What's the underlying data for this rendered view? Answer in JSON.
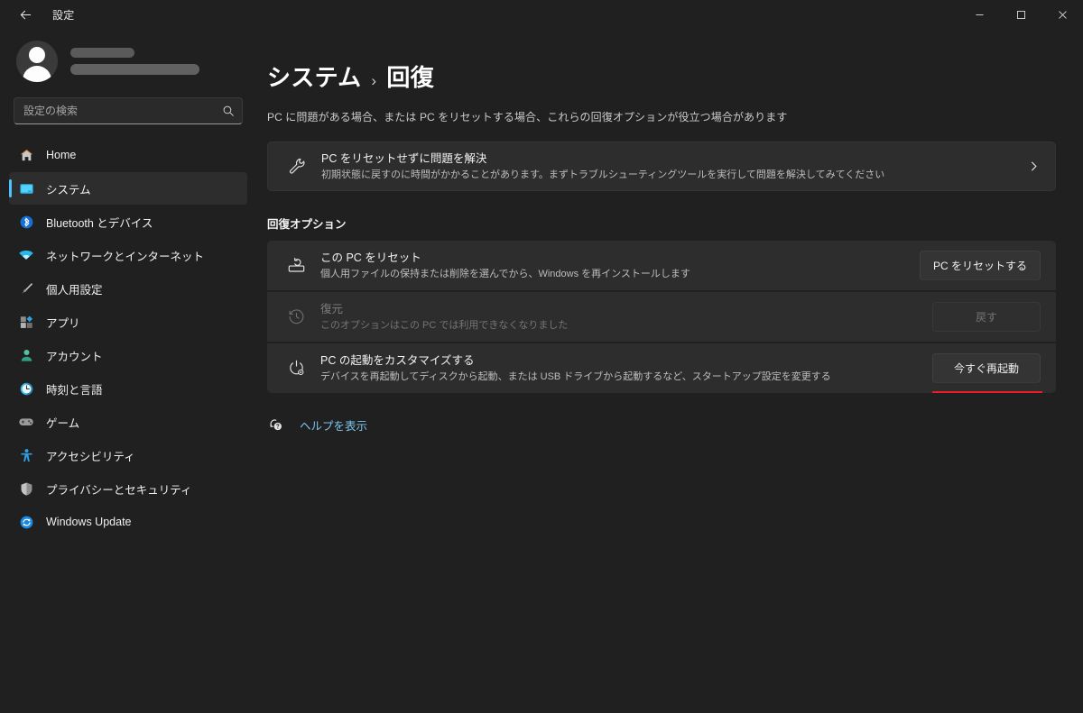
{
  "window": {
    "app_title": "設定",
    "back_label": "戻る",
    "controls": {
      "minimize": "最小化",
      "maximize": "最大化",
      "close": "閉じる"
    }
  },
  "sidebar": {
    "search": {
      "placeholder": "設定の検索",
      "value": ""
    },
    "items": [
      {
        "label": "Home",
        "icon": "home-icon",
        "selected": false
      },
      {
        "label": "システム",
        "icon": "system-monitor-icon",
        "selected": true
      },
      {
        "label": "Bluetooth とデバイス",
        "icon": "bluetooth-icon",
        "selected": false
      },
      {
        "label": "ネットワークとインターネット",
        "icon": "wifi-icon",
        "selected": false
      },
      {
        "label": "個人用設定",
        "icon": "paintbrush-icon",
        "selected": false
      },
      {
        "label": "アプリ",
        "icon": "apps-icon",
        "selected": false
      },
      {
        "label": "アカウント",
        "icon": "account-icon",
        "selected": false
      },
      {
        "label": "時刻と言語",
        "icon": "clock-icon",
        "selected": false
      },
      {
        "label": "ゲーム",
        "icon": "gamepad-icon",
        "selected": false
      },
      {
        "label": "アクセシビリティ",
        "icon": "accessibility-icon",
        "selected": false
      },
      {
        "label": "プライバシーとセキュリティ",
        "icon": "shield-icon",
        "selected": false
      },
      {
        "label": "Windows Update",
        "icon": "update-icon",
        "selected": false
      }
    ]
  },
  "main": {
    "breadcrumb": {
      "parent": "システム",
      "separator": "›",
      "current": "回復"
    },
    "subtitle": "PC に問題がある場合、または PC をリセットする場合、これらの回復オプションが役立つ場合があります",
    "troubleshoot_card": {
      "icon": "wrench-icon",
      "title": "PC をリセットせずに問題を解決",
      "description": "初期状態に戻すのに時間がかかることがあります。まずトラブルシューティングツールを実行して問題を解決してみてください",
      "chevron": "chevron-right-icon"
    },
    "section_title": "回復オプション",
    "options": [
      {
        "icon": "reset-pc-icon",
        "title": "この PC をリセット",
        "description": "個人用ファイルの保持または削除を選んでから、Windows を再インストールします",
        "button_label": "PC をリセットする",
        "disabled": false,
        "highlighted": false
      },
      {
        "icon": "history-clock-icon",
        "title": "復元",
        "description": "このオプションはこの PC では利用できなくなりました",
        "button_label": "戻す",
        "disabled": true,
        "highlighted": false
      },
      {
        "icon": "power-settings-icon",
        "title": "PC の起動をカスタマイズする",
        "description": "デバイスを再起動してディスクから起動、または USB ドライブから起動するなど、スタートアップ設定を変更する",
        "button_label": "今すぐ再起動",
        "disabled": false,
        "highlighted": true
      }
    ],
    "help": {
      "icon": "help-question-icon",
      "label": "ヘルプを表示"
    }
  },
  "colors": {
    "page_background": "#202020",
    "card_background": "#2d2d2d",
    "accent": "#4cc2ff",
    "link": "#7cc6ef",
    "highlight_underline": "#ee1c25"
  }
}
